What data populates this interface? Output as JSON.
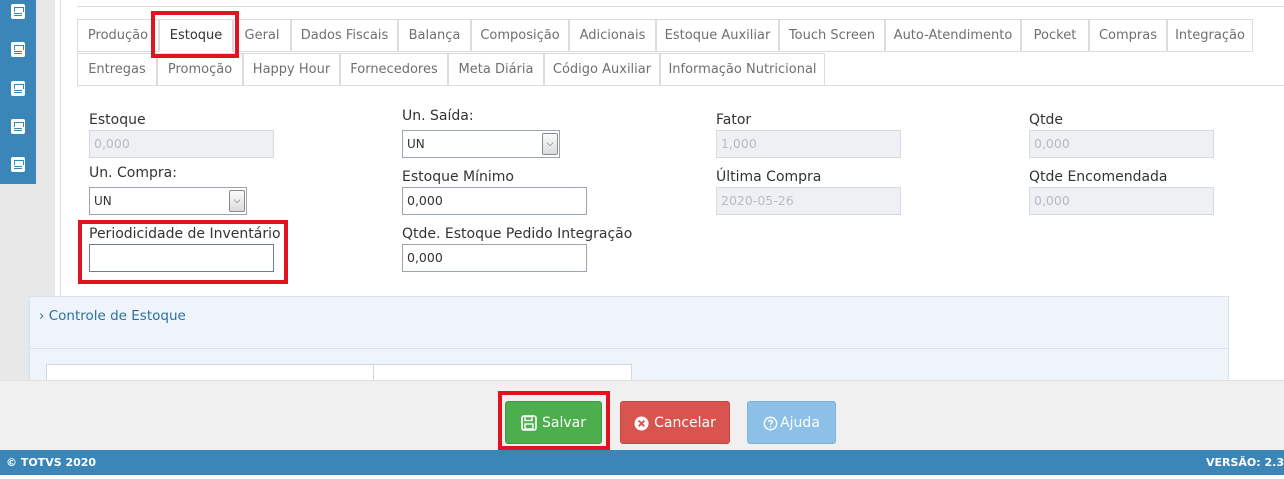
{
  "tabs": {
    "row1": [
      {
        "label": "Produção",
        "active": false
      },
      {
        "label": "Estoque",
        "active": true
      },
      {
        "label": "Geral",
        "active": false
      },
      {
        "label": "Dados Fiscais",
        "active": false
      },
      {
        "label": "Balança",
        "active": false
      },
      {
        "label": "Composição",
        "active": false
      },
      {
        "label": "Adicionais",
        "active": false
      },
      {
        "label": "Estoque Auxiliar",
        "active": false
      },
      {
        "label": "Touch Screen",
        "active": false
      },
      {
        "label": "Auto-Atendimento",
        "active": false
      },
      {
        "label": "Pocket",
        "active": false
      },
      {
        "label": "Compras",
        "active": false
      },
      {
        "label": "Integração",
        "active": false
      }
    ],
    "row2": [
      {
        "label": "Entregas"
      },
      {
        "label": "Promoção"
      },
      {
        "label": "Happy Hour"
      },
      {
        "label": "Fornecedores"
      },
      {
        "label": "Meta Diária"
      },
      {
        "label": "Código Auxiliar"
      },
      {
        "label": "Informação Nutricional"
      }
    ]
  },
  "form": {
    "estoque": {
      "label": "Estoque",
      "value": "0,000"
    },
    "un_saida": {
      "label": "Un. Saída:",
      "value": "UN"
    },
    "fator": {
      "label": "Fator",
      "value": "1,000"
    },
    "qtde": {
      "label": "Qtde",
      "value": "0,000"
    },
    "un_compra": {
      "label": "Un. Compra:",
      "value": "UN"
    },
    "estoque_minimo": {
      "label": "Estoque Mínimo",
      "value": "0,000"
    },
    "ultima_compra": {
      "label": "Última Compra",
      "value": "2020-05-26"
    },
    "qtde_encomendada": {
      "label": "Qtde Encomendada",
      "value": "0,000"
    },
    "periodicidade": {
      "label": "Periodicidade de Inventário",
      "value": ""
    },
    "qtde_estoque_pedido": {
      "label": "Qtde. Estoque Pedido Integração",
      "value": "0,000"
    }
  },
  "section": {
    "title": "Controle de Estoque",
    "chevron": "›"
  },
  "buttons": {
    "save": "Salvar",
    "cancel": "Cancelar",
    "help": "Ajuda"
  },
  "footer": {
    "copyright": "© TOTVS 2020",
    "version": "VERSÃO: 2.3"
  },
  "colors": {
    "accent": "#3a86b9",
    "save": "#4cae4c",
    "cancel": "#d9534f",
    "help": "#8cc0e6",
    "highlight": "#e0141e"
  },
  "icons": [
    "sidebar-doc-icon",
    "save-icon",
    "cancel-icon",
    "help-icon",
    "chevron-right-icon",
    "select-arrow-icon"
  ]
}
